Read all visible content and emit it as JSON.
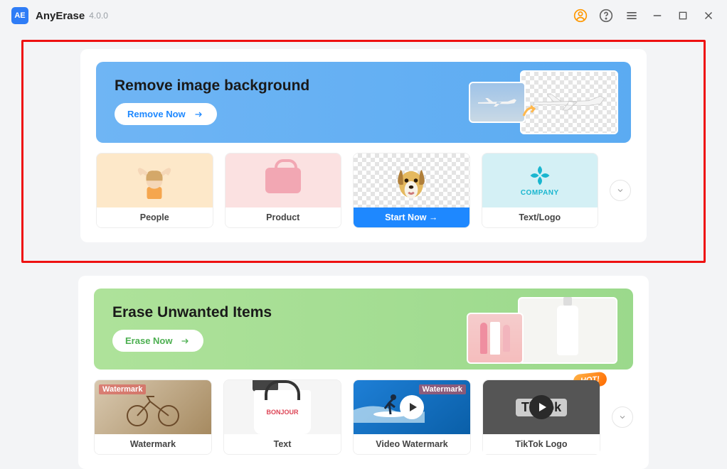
{
  "app": {
    "name": "AnyErase",
    "version": "4.0.0",
    "logo_text": "AE"
  },
  "section1": {
    "hero_title": "Remove image background",
    "hero_button": "Remove Now",
    "options": [
      {
        "label": "People"
      },
      {
        "label": "Product"
      },
      {
        "label": "Start Now →",
        "active": true
      },
      {
        "label": "Text/Logo"
      }
    ],
    "company_text": "COMPANY"
  },
  "section2": {
    "hero_title": "Erase Unwanted Items",
    "hero_button": "Erase Now",
    "options": [
      {
        "label": "Watermark",
        "tag": "Watermark"
      },
      {
        "label": "Text",
        "bag_text": "BONJOUR"
      },
      {
        "label": "Video Watermark",
        "tag": "Watermark"
      },
      {
        "label": "TikTok Logo",
        "tiktok": "TikTok",
        "hot": "HOT!"
      }
    ]
  }
}
